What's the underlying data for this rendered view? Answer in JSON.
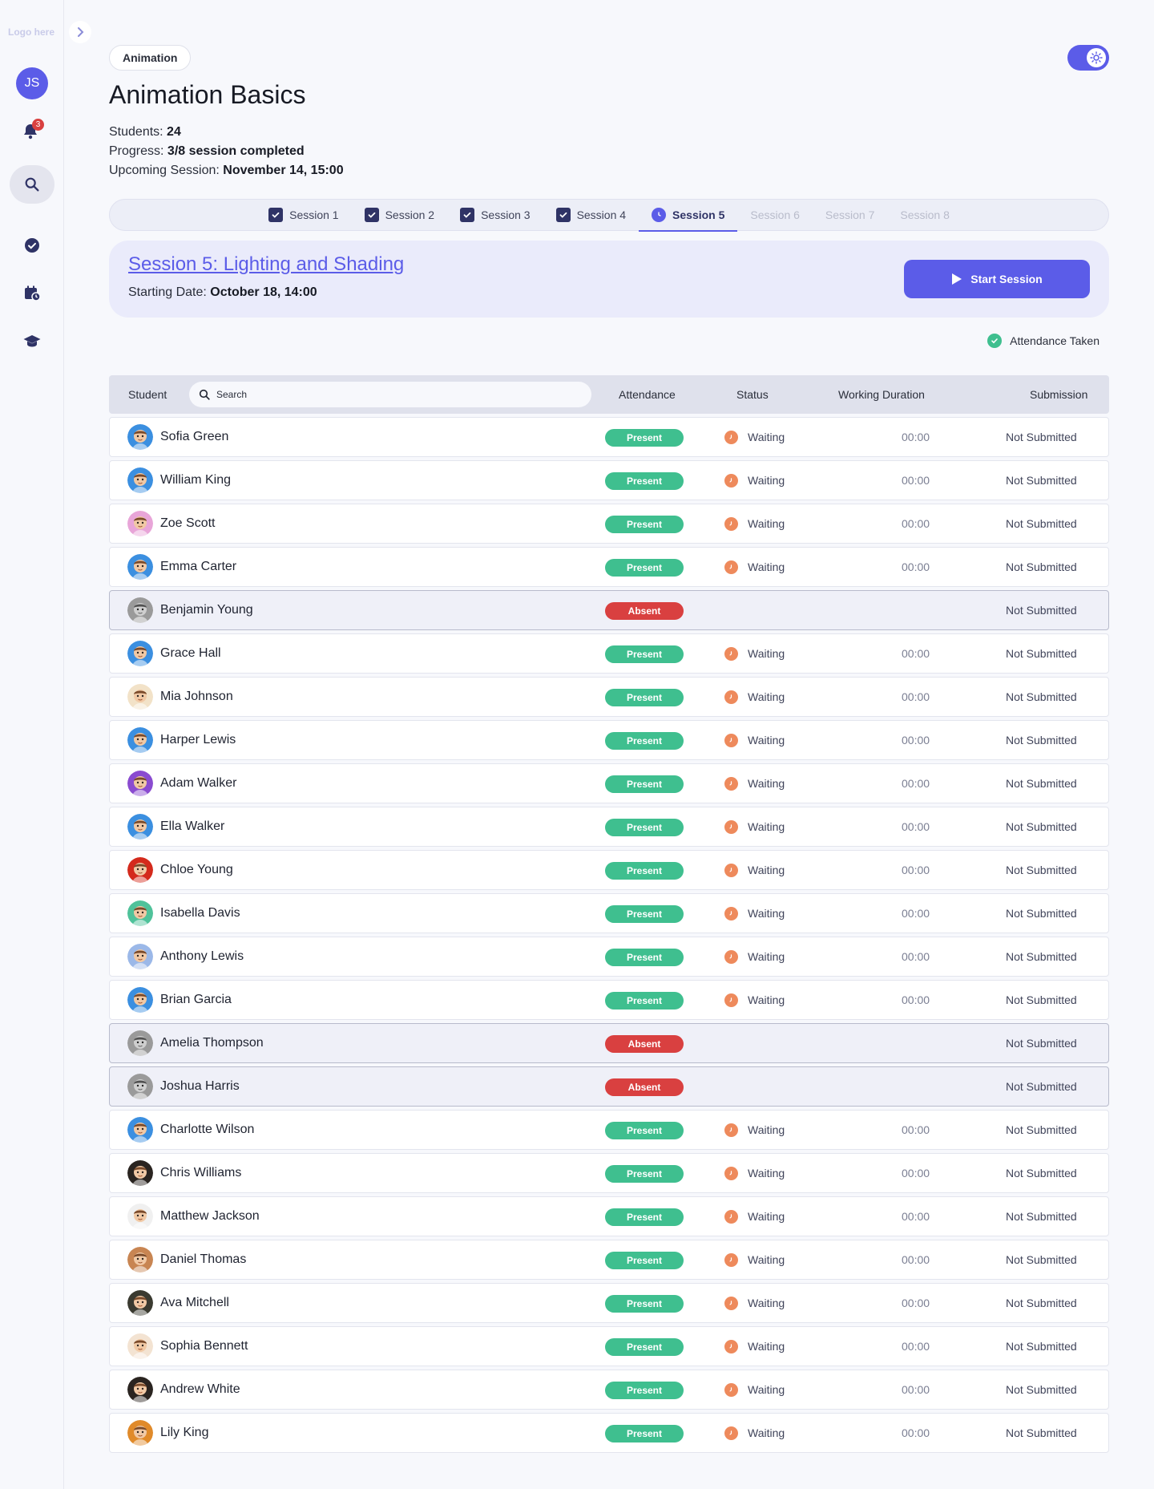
{
  "sidebar": {
    "logo": "Logo here",
    "user_initials": "JS",
    "notification_count": "3",
    "nav_icons": [
      "bell-icon",
      "search-icon",
      "check-circle-icon",
      "calendar-clock-icon",
      "graduation-cap-icon"
    ]
  },
  "header": {
    "tag": "Animation",
    "title": "Animation Basics",
    "students_label": "Students: ",
    "students_value": "24",
    "progress_label": "Progress: ",
    "progress_value": "3/8 session completed",
    "upcoming_label": "Upcoming Session: ",
    "upcoming_value": "November 14, 15:00"
  },
  "tabs": [
    {
      "label": "Session 1",
      "state": "done"
    },
    {
      "label": "Session 2",
      "state": "done"
    },
    {
      "label": "Session 3",
      "state": "done"
    },
    {
      "label": "Session 4",
      "state": "done"
    },
    {
      "label": "Session 5",
      "state": "active"
    },
    {
      "label": "Session 6",
      "state": "disabled"
    },
    {
      "label": "Session 7",
      "state": "disabled"
    },
    {
      "label": "Session 8",
      "state": "disabled"
    }
  ],
  "session": {
    "title": "Session 5: Lighting and Shading",
    "date_label": "Starting Date: ",
    "date_value": "October 18, 14:00",
    "start_button": "Start Session",
    "attendance_taken": "Attendance Taken"
  },
  "table": {
    "headers": {
      "student": "Student",
      "search_placeholder": "Search",
      "attendance": "Attendance",
      "status": "Status",
      "duration": "Working Duration",
      "submission": "Submission"
    },
    "rows": [
      {
        "name": "Sofia Green",
        "attendance": "Present",
        "status": "Waiting",
        "duration": "00:00",
        "submission": "Not Submitted",
        "color": "#3b8fe0"
      },
      {
        "name": "William King",
        "attendance": "Present",
        "status": "Waiting",
        "duration": "00:00",
        "submission": "Not Submitted",
        "color": "#3b8fe0"
      },
      {
        "name": "Zoe Scott",
        "attendance": "Present",
        "status": "Waiting",
        "duration": "00:00",
        "submission": "Not Submitted",
        "color": "#e8a5d8"
      },
      {
        "name": "Emma Carter",
        "attendance": "Present",
        "status": "Waiting",
        "duration": "00:00",
        "submission": "Not Submitted",
        "color": "#3b8fe0"
      },
      {
        "name": "Benjamin Young",
        "attendance": "Absent",
        "status": "",
        "duration": "",
        "submission": "Not Submitted",
        "color": "#9a9a9a"
      },
      {
        "name": "Grace Hall",
        "attendance": "Present",
        "status": "Waiting",
        "duration": "00:00",
        "submission": "Not Submitted",
        "color": "#3b8fe0"
      },
      {
        "name": "Mia Johnson",
        "attendance": "Present",
        "status": "Waiting",
        "duration": "00:00",
        "submission": "Not Submitted",
        "color": "#f2e2c8"
      },
      {
        "name": "Harper Lewis",
        "attendance": "Present",
        "status": "Waiting",
        "duration": "00:00",
        "submission": "Not Submitted",
        "color": "#3b8fe0"
      },
      {
        "name": "Adam Walker",
        "attendance": "Present",
        "status": "Waiting",
        "duration": "00:00",
        "submission": "Not Submitted",
        "color": "#8a4bd0"
      },
      {
        "name": "Ella Walker",
        "attendance": "Present",
        "status": "Waiting",
        "duration": "00:00",
        "submission": "Not Submitted",
        "color": "#3b8fe0"
      },
      {
        "name": "Chloe Young",
        "attendance": "Present",
        "status": "Waiting",
        "duration": "00:00",
        "submission": "Not Submitted",
        "color": "#d42a1c"
      },
      {
        "name": "Isabella Davis",
        "attendance": "Present",
        "status": "Waiting",
        "duration": "00:00",
        "submission": "Not Submitted",
        "color": "#4fc29a"
      },
      {
        "name": "Anthony Lewis",
        "attendance": "Present",
        "status": "Waiting",
        "duration": "00:00",
        "submission": "Not Submitted",
        "color": "#9bb8e8"
      },
      {
        "name": "Brian Garcia",
        "attendance": "Present",
        "status": "Waiting",
        "duration": "00:00",
        "submission": "Not Submitted",
        "color": "#3b8fe0"
      },
      {
        "name": "Amelia Thompson",
        "attendance": "Absent",
        "status": "",
        "duration": "",
        "submission": "Not Submitted",
        "color": "#9a9a9a"
      },
      {
        "name": "Joshua Harris",
        "attendance": "Absent",
        "status": "",
        "duration": "",
        "submission": "Not Submitted",
        "color": "#9a9a9a"
      },
      {
        "name": "Charlotte Wilson",
        "attendance": "Present",
        "status": "Waiting",
        "duration": "00:00",
        "submission": "Not Submitted",
        "color": "#3b8fe0"
      },
      {
        "name": "Chris Williams",
        "attendance": "Present",
        "status": "Waiting",
        "duration": "00:00",
        "submission": "Not Submitted",
        "color": "#2a2420"
      },
      {
        "name": "Matthew Jackson",
        "attendance": "Present",
        "status": "Waiting",
        "duration": "00:00",
        "submission": "Not Submitted",
        "color": "#f0f0f0"
      },
      {
        "name": "Daniel Thomas",
        "attendance": "Present",
        "status": "Waiting",
        "duration": "00:00",
        "submission": "Not Submitted",
        "color": "#c88552"
      },
      {
        "name": "Ava Mitchell",
        "attendance": "Present",
        "status": "Waiting",
        "duration": "00:00",
        "submission": "Not Submitted",
        "color": "#3a3a30"
      },
      {
        "name": "Sophia Bennett",
        "attendance": "Present",
        "status": "Waiting",
        "duration": "00:00",
        "submission": "Not Submitted",
        "color": "#f3e3d2"
      },
      {
        "name": "Andrew White",
        "attendance": "Present",
        "status": "Waiting",
        "duration": "00:00",
        "submission": "Not Submitted",
        "color": "#2a2420"
      },
      {
        "name": "Lily King",
        "attendance": "Present",
        "status": "Waiting",
        "duration": "00:00",
        "submission": "Not Submitted",
        "color": "#e08a2a"
      }
    ]
  },
  "colors": {
    "accent": "#5b5ce8",
    "present": "#3fbf8f",
    "absent": "#d94040",
    "waiting": "#ee8a5c"
  }
}
